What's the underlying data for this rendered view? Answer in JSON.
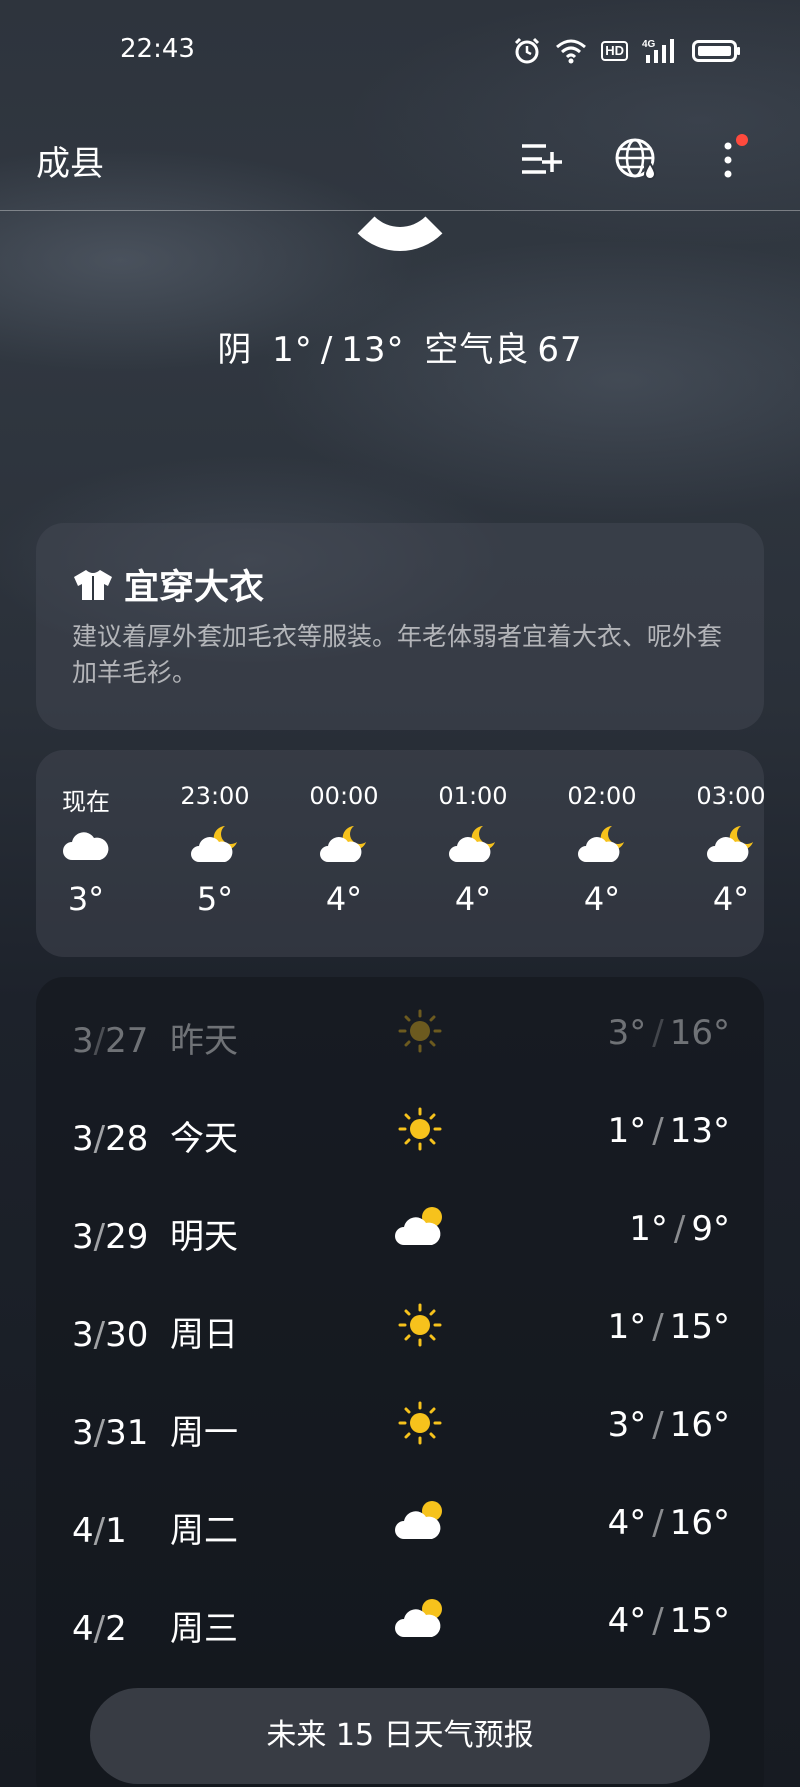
{
  "status_bar": {
    "time": "22:43",
    "hd_label": "HD",
    "network_label": "4G",
    "icons": [
      "alarm-icon",
      "wifi-icon",
      "hd-icon",
      "signal-icon",
      "battery-icon"
    ]
  },
  "header": {
    "city": "成县",
    "icons": [
      "add-city-icon",
      "globe-weather-icon",
      "more-icon"
    ],
    "notification_dot_color": "#ff4a3d"
  },
  "current": {
    "condition": "阴",
    "low": "1°",
    "separator": "/",
    "high": "13°",
    "aqi_label": "空气良",
    "aqi_value": "67"
  },
  "clothing": {
    "title": "宜穿大衣",
    "description": "建议着厚外套加毛衣等服装。年老体弱者宜着大衣、呢外套加羊毛衫。",
    "icon": "shirt-icon"
  },
  "hourly": [
    {
      "time": "现在",
      "icon": "cloud-icon",
      "temp": "3°"
    },
    {
      "time": "23:00",
      "icon": "cloud-moon-icon",
      "temp": "5°"
    },
    {
      "time": "00:00",
      "icon": "cloud-moon-icon",
      "temp": "4°"
    },
    {
      "time": "01:00",
      "icon": "cloud-moon-icon",
      "temp": "4°"
    },
    {
      "time": "02:00",
      "icon": "cloud-moon-icon",
      "temp": "4°"
    },
    {
      "time": "03:00",
      "icon": "cloud-moon-icon",
      "temp": "4°"
    }
  ],
  "daily": [
    {
      "month": "3",
      "day": "27",
      "label": "昨天",
      "icon": "sun-icon",
      "low": "3°",
      "high": "16°",
      "past": true
    },
    {
      "month": "3",
      "day": "28",
      "label": "今天",
      "icon": "sun-icon",
      "low": "1°",
      "high": "13°",
      "past": false
    },
    {
      "month": "3",
      "day": "29",
      "label": "明天",
      "icon": "cloud-sun-icon",
      "low": "1°",
      "high": "9°",
      "past": false
    },
    {
      "month": "3",
      "day": "30",
      "label": "周日",
      "icon": "sun-icon",
      "low": "1°",
      "high": "15°",
      "past": false
    },
    {
      "month": "3",
      "day": "31",
      "label": "周一",
      "icon": "sun-icon",
      "low": "3°",
      "high": "16°",
      "past": false
    },
    {
      "month": "4",
      "day": "1",
      "label": "周二",
      "icon": "cloud-sun-icon",
      "low": "4°",
      "high": "16°",
      "past": false
    },
    {
      "month": "4",
      "day": "2",
      "label": "周三",
      "icon": "cloud-sun-icon",
      "low": "4°",
      "high": "15°",
      "past": false
    }
  ],
  "forecast_button": "未来 15 日天气预报",
  "colors": {
    "sun": "#f6c21c",
    "moon": "#f6c21c",
    "cloud": "#ffffff"
  }
}
